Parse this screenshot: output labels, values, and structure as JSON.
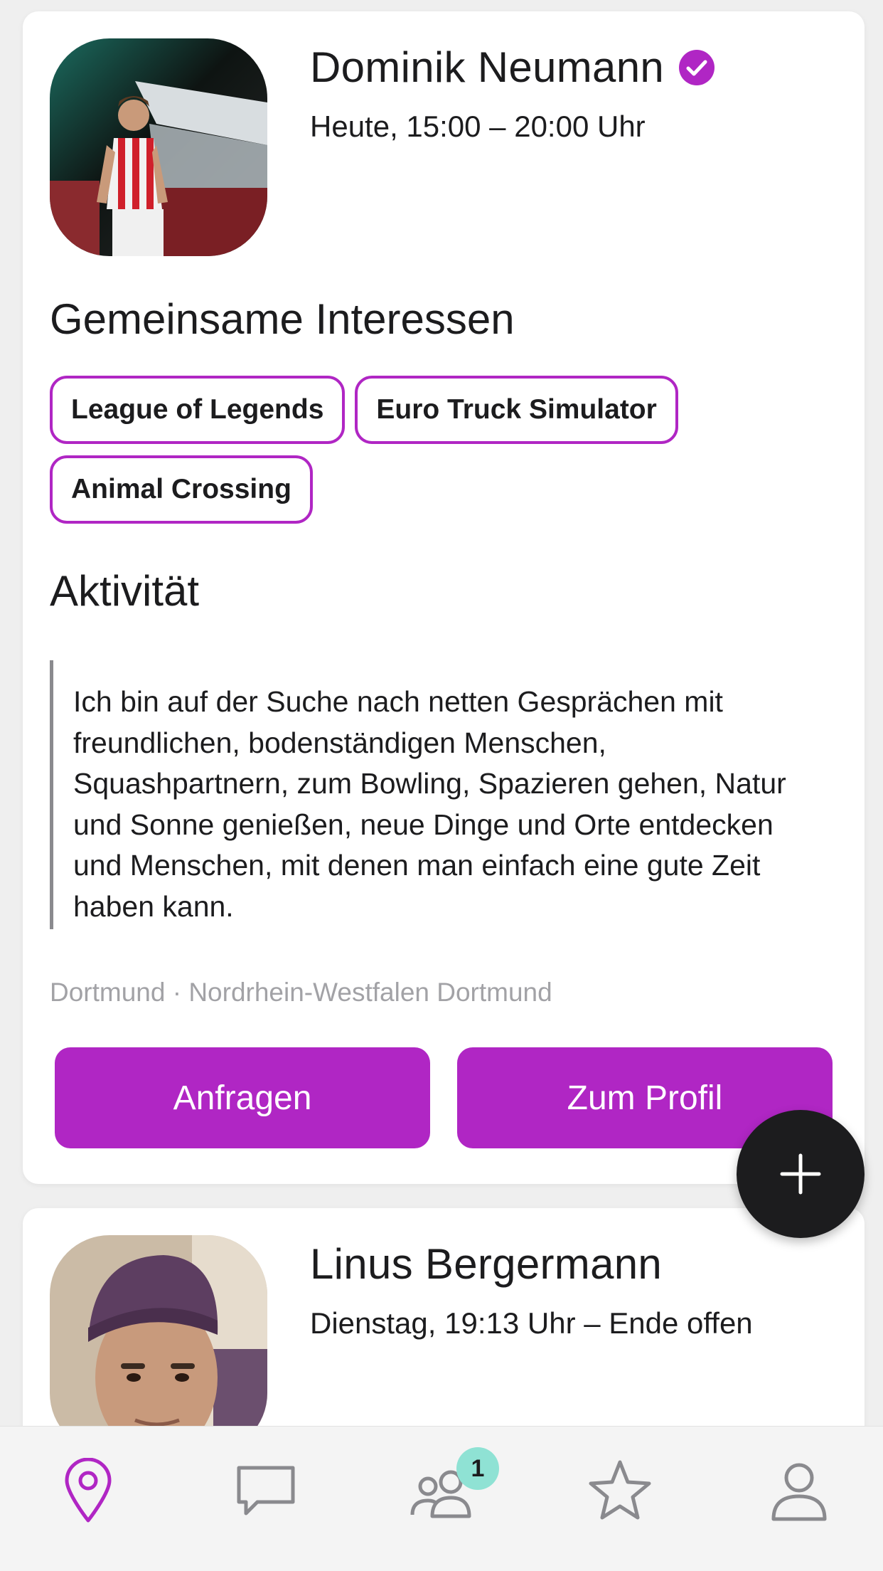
{
  "colors": {
    "accent": "#b026c4",
    "card": "#ffffff",
    "background": "#efefef",
    "text": "#1c1c1e",
    "muted": "#a2a2a6",
    "badge": "#8fe2d4",
    "fab": "#1c1c1e"
  },
  "cards": [
    {
      "name": "Dominik Neumann",
      "verified": true,
      "verified_icon": "verified-check-icon",
      "time": "Heute, 15:00 – 20:00 Uhr",
      "interests_title": "Gemeinsame Interessen",
      "interests": [
        "League of Legends",
        "Euro Truck Simulator",
        "Animal Crossing"
      ],
      "activity_title": "Aktivität",
      "activity_text": "Ich bin auf der Suche nach netten Gesprächen mit freundlichen, bodenständigen Menschen, Squashpartnern, zum Bowling, Spazieren gehen, Natur und Sonne genießen, neue Dinge und Orte entdecken und Menschen, mit denen man einfach eine gute Zeit haben kann.",
      "location": "Dortmund · Nordrhein-Westfalen Dortmund",
      "buttons": {
        "request": "Anfragen",
        "profile": "Zum Profil"
      }
    },
    {
      "name": "Linus Bergermann",
      "time": "Dienstag, 19:13 Uhr – Ende offen"
    }
  ],
  "fab": {
    "icon": "plus-icon"
  },
  "tabbar": {
    "items": [
      {
        "icon": "map-pin-icon",
        "active": true
      },
      {
        "icon": "chat-bubble-icon",
        "active": false
      },
      {
        "icon": "friends-icon",
        "active": false,
        "badge": "1"
      },
      {
        "icon": "star-icon",
        "active": false
      },
      {
        "icon": "person-icon",
        "active": false
      }
    ]
  }
}
